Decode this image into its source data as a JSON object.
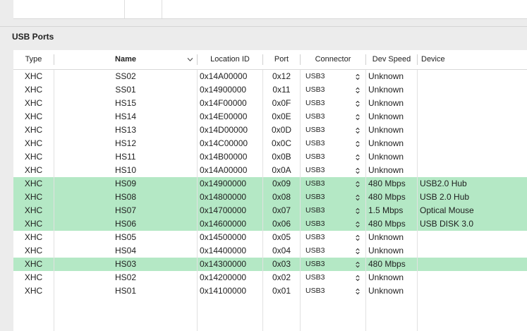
{
  "section": {
    "title": "USB Ports"
  },
  "table": {
    "columns": {
      "type": "Type",
      "name": "Name",
      "location": "Location ID",
      "port": "Port",
      "connector": "Connector",
      "speed": "Dev Speed",
      "device": "Device"
    },
    "rows": [
      {
        "type": "XHC",
        "name": "SS02",
        "location": "0x14A00000",
        "port": "0x12",
        "connector": "USB3",
        "speed": "Unknown",
        "device": "",
        "highlight": false
      },
      {
        "type": "XHC",
        "name": "SS01",
        "location": "0x14900000",
        "port": "0x11",
        "connector": "USB3",
        "speed": "Unknown",
        "device": "",
        "highlight": false
      },
      {
        "type": "XHC",
        "name": "HS15",
        "location": "0x14F00000",
        "port": "0x0F",
        "connector": "USB3",
        "speed": "Unknown",
        "device": "",
        "highlight": false
      },
      {
        "type": "XHC",
        "name": "HS14",
        "location": "0x14E00000",
        "port": "0x0E",
        "connector": "USB3",
        "speed": "Unknown",
        "device": "",
        "highlight": false
      },
      {
        "type": "XHC",
        "name": "HS13",
        "location": "0x14D00000",
        "port": "0x0D",
        "connector": "USB3",
        "speed": "Unknown",
        "device": "",
        "highlight": false
      },
      {
        "type": "XHC",
        "name": "HS12",
        "location": "0x14C00000",
        "port": "0x0C",
        "connector": "USB3",
        "speed": "Unknown",
        "device": "",
        "highlight": false
      },
      {
        "type": "XHC",
        "name": "HS11",
        "location": "0x14B00000",
        "port": "0x0B",
        "connector": "USB3",
        "speed": "Unknown",
        "device": "",
        "highlight": false
      },
      {
        "type": "XHC",
        "name": "HS10",
        "location": "0x14A00000",
        "port": "0x0A",
        "connector": "USB3",
        "speed": "Unknown",
        "device": "",
        "highlight": false
      },
      {
        "type": "XHC",
        "name": "HS09",
        "location": "0x14900000",
        "port": "0x09",
        "connector": "USB3",
        "speed": "480 Mbps",
        "device": "USB2.0 Hub",
        "highlight": true
      },
      {
        "type": "XHC",
        "name": "HS08",
        "location": "0x14800000",
        "port": "0x08",
        "connector": "USB3",
        "speed": "480 Mbps",
        "device": "USB 2.0 Hub",
        "highlight": true
      },
      {
        "type": "XHC",
        "name": "HS07",
        "location": "0x14700000",
        "port": "0x07",
        "connector": "USB3",
        "speed": "1.5 Mbps",
        "device": "Optical Mouse",
        "highlight": true
      },
      {
        "type": "XHC",
        "name": "HS06",
        "location": "0x14600000",
        "port": "0x06",
        "connector": "USB3",
        "speed": "480 Mbps",
        "device": "USB DISK 3.0",
        "highlight": true
      },
      {
        "type": "XHC",
        "name": "HS05",
        "location": "0x14500000",
        "port": "0x05",
        "connector": "USB3",
        "speed": "Unknown",
        "device": "",
        "highlight": false
      },
      {
        "type": "XHC",
        "name": "HS04",
        "location": "0x14400000",
        "port": "0x04",
        "connector": "USB3",
        "speed": "Unknown",
        "device": "",
        "highlight": false
      },
      {
        "type": "XHC",
        "name": "HS03",
        "location": "0x14300000",
        "port": "0x03",
        "connector": "USB3",
        "speed": "480 Mbps",
        "device": "",
        "highlight": true
      },
      {
        "type": "XHC",
        "name": "HS02",
        "location": "0x14200000",
        "port": "0x02",
        "connector": "USB3",
        "speed": "Unknown",
        "device": "",
        "highlight": false
      },
      {
        "type": "XHC",
        "name": "HS01",
        "location": "0x14100000",
        "port": "0x01",
        "connector": "USB3",
        "speed": "Unknown",
        "device": "",
        "highlight": false
      }
    ]
  },
  "colors": {
    "highlight_row": "#b4e8c5",
    "window_background": "#ececec",
    "table_background": "#ffffff"
  },
  "icons": {
    "sort_indicator": "chevron-down-icon",
    "connector_popup": "up-down-stepper-icon"
  }
}
